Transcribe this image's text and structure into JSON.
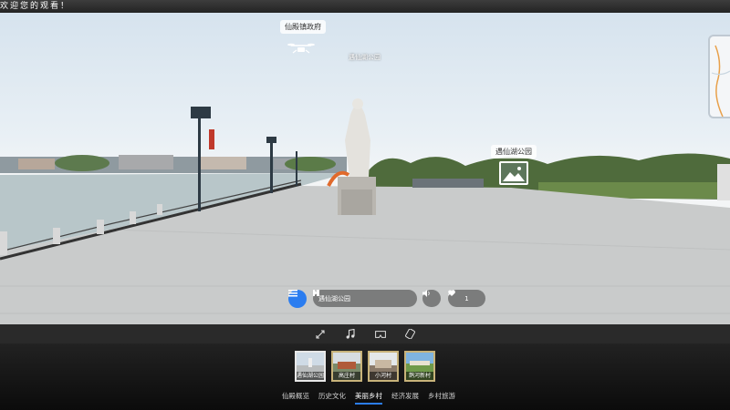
{
  "marquee": {
    "text": "欢迎您的观看！"
  },
  "hotspots": {
    "government_label": "仙殿镇政府",
    "park_text": "遇仙湖公园",
    "park_label": "遇仙湖公园"
  },
  "player": {
    "track_title": "遇仙湖公园",
    "like_count": "1"
  },
  "scenes": [
    {
      "label": "遇仙湖公园",
      "active": true
    },
    {
      "label": "高庄村",
      "active": false
    },
    {
      "label": "小河村",
      "active": false
    },
    {
      "label": "鹊河新村",
      "active": false
    }
  ],
  "categories": [
    {
      "label": "仙殿概览",
      "active": false
    },
    {
      "label": "历史文化",
      "active": false
    },
    {
      "label": "美丽乡村",
      "active": true
    },
    {
      "label": "经济发展",
      "active": false
    },
    {
      "label": "乡村旅游",
      "active": false
    }
  ],
  "icons": {
    "menu": "menu-icon",
    "prev": "previous-icon",
    "pause": "pause-icon",
    "next": "next-icon",
    "sound": "speaker-icon",
    "like": "heart-icon",
    "share": "share-icon",
    "fullscreen": "expand-icon",
    "music": "music-note-icon",
    "vr": "vr-glasses-icon",
    "gyro": "gyroscope-icon",
    "drone": "drone-icon",
    "picture": "picture-icon"
  },
  "colors": {
    "accent": "#2b7df0",
    "thumb_border": "#c8b37a"
  }
}
